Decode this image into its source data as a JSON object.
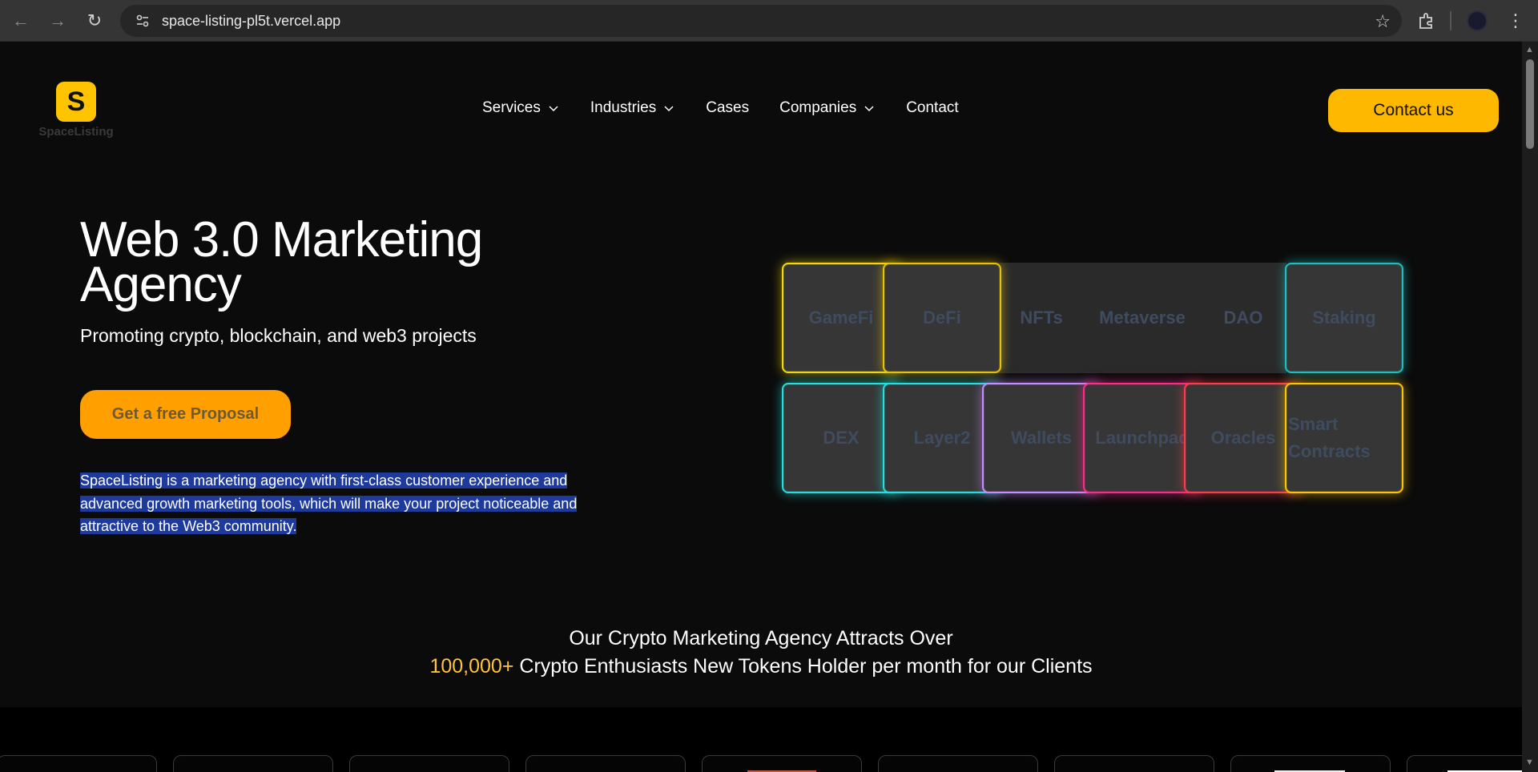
{
  "browser": {
    "url": "space-listing-pl5t.vercel.app"
  },
  "header": {
    "logo_letter": "S",
    "logo_text": "SpaceListing",
    "nav": [
      {
        "label": "Services",
        "dropdown": true
      },
      {
        "label": "Industries",
        "dropdown": true
      },
      {
        "label": "Cases",
        "dropdown": false
      },
      {
        "label": "Companies",
        "dropdown": true
      },
      {
        "label": "Contact",
        "dropdown": false
      }
    ],
    "contact_button": "Contact us"
  },
  "hero": {
    "title": "Web 3.0 Marketing Agency",
    "subtitle": "Promoting crypto, blockchain, and web3 projects",
    "cta": "Get a free Proposal",
    "description": "SpaceListing is a marketing agency with first-class customer experience and advanced growth marketing tools, which will make your project noticeable and attractive to the Web3 community."
  },
  "categories": {
    "row1": [
      {
        "label": "GameFi",
        "glow": "#f5d90a"
      },
      {
        "label": "DeFi",
        "glow": "#e8c400"
      },
      {
        "label": "NFTs",
        "glow": null
      },
      {
        "label": "Metaverse",
        "glow": null
      },
      {
        "label": "DAO",
        "glow": null
      },
      {
        "label": "Staking",
        "glow": "#1fbfbf"
      }
    ],
    "row2": [
      {
        "label": "DEX",
        "glow": "#22e0e0"
      },
      {
        "label": "Layer2",
        "glow": "#22e0e0"
      },
      {
        "label": "Wallets",
        "glow": "#c58bff"
      },
      {
        "label": "Launchpad",
        "glow": "#ff2a8a"
      },
      {
        "label": "Oracles",
        "glow": "#ff3a4a"
      },
      {
        "label": "Smart Contracts",
        "glow": "#ffc400"
      }
    ]
  },
  "stats": {
    "line1": "Our Crypto Marketing Agency Attracts Over",
    "highlight": "100,000+",
    "line2": " Crypto Enthusiasts New Tokens Holder per month for our Clients"
  },
  "colors": {
    "accent": "#ffb800",
    "cta": "#ff9f00",
    "highlight": "#ffc43a",
    "selection": "#1d3a9c"
  }
}
